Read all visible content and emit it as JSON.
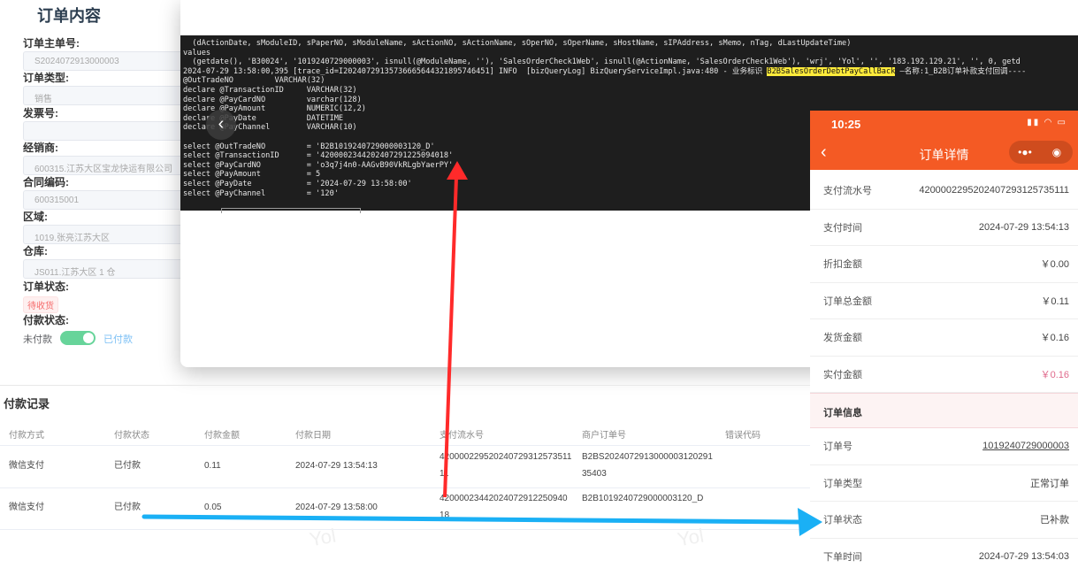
{
  "form": {
    "title": "订单内容",
    "fields": [
      {
        "label": "订单主单号:",
        "value": "S2024072913000003"
      },
      {
        "label": "订单类型:",
        "value": "销售"
      },
      {
        "label": "发票号:",
        "value": ""
      },
      {
        "label": "经销商:",
        "value": "600315.江苏大区宝龙快运有限公司"
      },
      {
        "label": "合同编码:",
        "value": "600315001"
      },
      {
        "label": "区域:",
        "value": "1019.张亮江苏大区"
      },
      {
        "label": "仓库:",
        "value": "JS011.江苏大区 1 仓"
      }
    ],
    "order_status_label": "订单状态:",
    "order_status": "待收货",
    "pay_status_label": "付款状态:",
    "pay_off": "未付款",
    "pay_on": "已付款",
    "pay_switch_on": true
  },
  "terminal": {
    "lines": [
      "  (dActionDate, sModuleID, sPaperNO, sModuleName, sActionNO, sActionName, sOperNO, sOperName, sHostName, sIPAddress, sMemo, nTag, dLastUpdateTime)",
      "values",
      "  (getdate(), 'B30024', '1019240729000003', isnull(@ModuleName, ''), 'SalesOrderCheck1Web', isnull(@ActionName, 'SalesOrderCheck1Web'), 'wrj', 'Yol', '', '183.192.129.21', '', 0, getd",
      "@OutTradeNO         VARCHAR(32)",
      "declare @TransactionID     VARCHAR(32)",
      "declare @PayCardNO         varchar(128)",
      "declare @PayAmount         NUMERIC(12,2)",
      "declare @PayDate           DATETIME",
      "declare @PayChannel        VARCHAR(10)",
      "",
      "select @OutTradeNO         = 'B2B1019240729000003120_D'",
      "select @TransactionID      = '4200002344202407291225094018'",
      "select @PayCardNO          = 'o3q7j4n0-AAGvB90VkRLgbYaerPY'",
      "select @PayAmount          = 5",
      "select @PayDate            = '2024-07-29 13:58:00'",
      "select @PayChannel         = '120'"
    ],
    "log_prefix": "2024-07-29 13:58:00,395 [trace_id=I20240729135736665644321895746451] INFO  [bizQueryLog] BizQueryServiceImpl.java:480 - 业务标识 ",
    "log_highlight": "B2BSalesOrderDebtPayCallBack",
    "log_suffix": " —名称:1_B2B订单补款支付回调----"
  },
  "payments": {
    "title": "付款记录",
    "headers": [
      "付款方式",
      "付款状态",
      "付款金额",
      "付款日期",
      "支付流水号",
      "商户订单号",
      "错误代码"
    ],
    "rows": [
      [
        "微信支付",
        "已付款",
        "0.11",
        "2024-07-29 13:54:13",
        "42000022952024072931257351111",
        "B2BS202407291300000312029135403",
        ""
      ],
      [
        "微信支付",
        "已付款",
        "0.05",
        "2024-07-29 13:58:00",
        "4200002344202407291225094018",
        "B2B1019240729000003120_D",
        ""
      ]
    ],
    "watermark": "Yol"
  },
  "phone": {
    "time": "10:25",
    "title": "订单详情",
    "rows": [
      {
        "label": "支付流水号",
        "value": "4200002295202407293125735111"
      },
      {
        "label": "支付时间",
        "value": "2024-07-29 13:54:13"
      },
      {
        "label": "折扣金额",
        "value": "￥0.00"
      },
      {
        "label": "订单总金额",
        "value": "￥0.11"
      },
      {
        "label": "发货金额",
        "value": "￥0.16"
      },
      {
        "label": "实付金额",
        "value": "￥0.16"
      }
    ],
    "section": "订单信息",
    "info": [
      {
        "label": "订单号",
        "value": "1019240729000003"
      },
      {
        "label": "订单类型",
        "value": "正常订单"
      },
      {
        "label": "订单状态",
        "value": "已补款"
      },
      {
        "label": "下单时间",
        "value": "2024-07-29 13:54:03"
      }
    ]
  },
  "colors": {
    "accent": "#f45a24",
    "red_arrow": "#ff2a2a",
    "blue_arrow": "#1ab0f5"
  }
}
